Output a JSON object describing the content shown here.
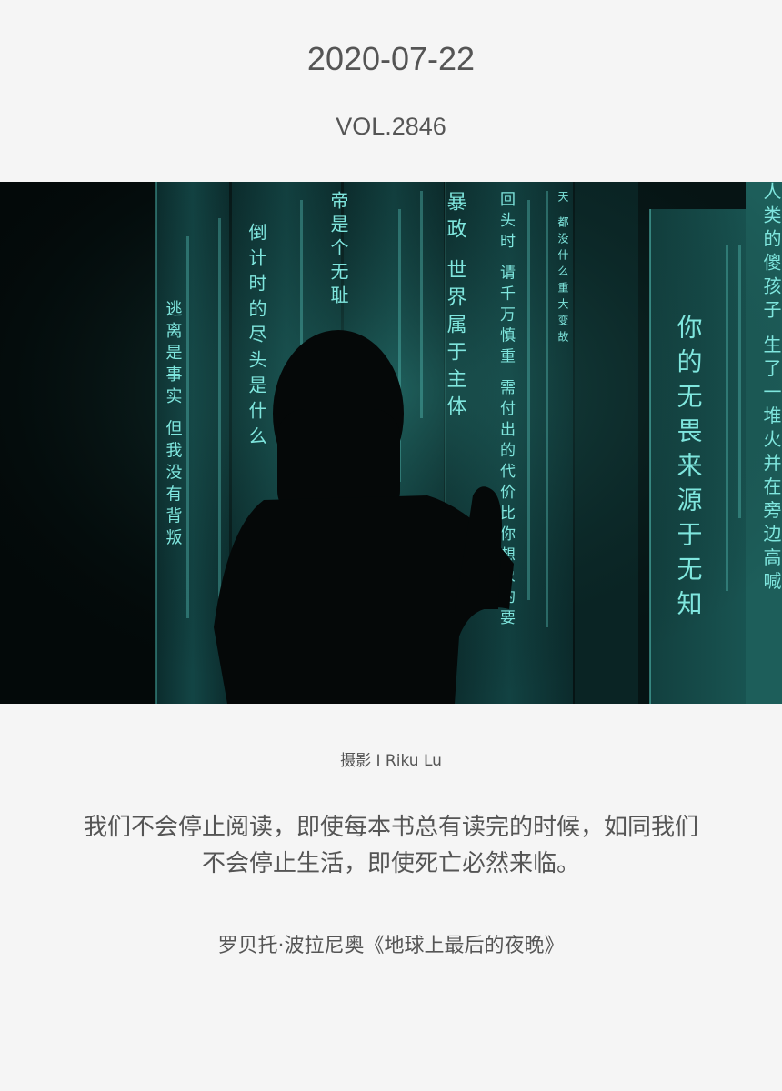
{
  "header": {
    "date": "2020-07-22",
    "volume": "VOL.2846"
  },
  "photo": {
    "credit": "摄影 I Riku Lu",
    "colors": {
      "background": "#061414",
      "panel": "#0f3a3a",
      "glow": "#7fe6de",
      "silhouette": "#050808"
    },
    "panel_texts": {
      "left": "逃离是事实 但我没有背叛",
      "left_mid": "倒计时的尽头是什么",
      "center_a": "帝是个无耻",
      "center_b": "暴政 世界属于主体",
      "center_c": "回头时 请千万慎重 需付出的代价比你想象的要",
      "center_d": "天 都没什么重大变故",
      "right_big": "你的无畏来源于无知",
      "right_edge": "人类的傻孩子 生了一堆火并在旁边高喊"
    }
  },
  "quote": {
    "line1": "我们不会停止阅读，即使每本书总有读完的时候，如同我们",
    "line2": "不会停止生活，即使死亡必然来临。"
  },
  "source": "罗贝托·波拉尼奥《地球上最后的夜晚》"
}
